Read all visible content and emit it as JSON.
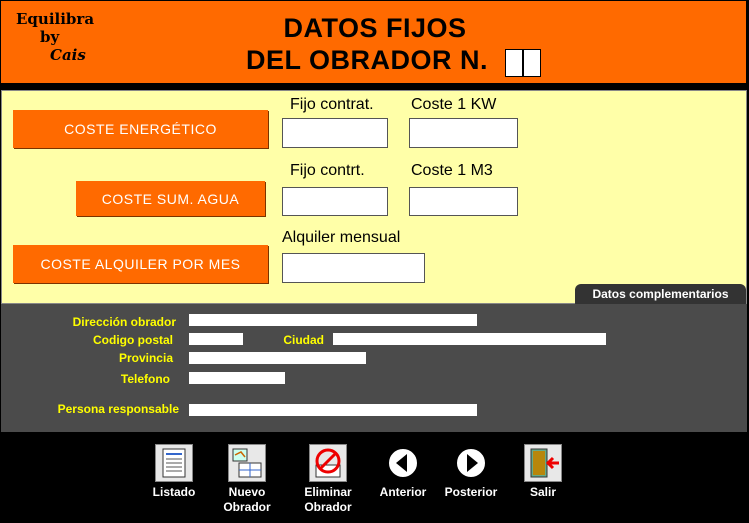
{
  "brand": {
    "line1": "Equilibra",
    "line2": "by",
    "line3": "Cais"
  },
  "header": {
    "title_line1": "DATOS FIJOS",
    "title_line2": "DEL OBRADOR N."
  },
  "costs": {
    "energy": {
      "button": "COSTE  ENERGÉTICO",
      "label1": "Fijo contrat.",
      "label2": "Coste 1 KW",
      "value1": "",
      "value2": ""
    },
    "water": {
      "button": "COSTE SUM. AGUA",
      "label1": "Fijo contrt.",
      "label2": "Coste 1 M3",
      "value1": "",
      "value2": ""
    },
    "rent": {
      "button": "COSTE ALQUILER POR MES",
      "label1": "Alquiler mensual",
      "value1": ""
    }
  },
  "tab": {
    "label": "Datos complementarios"
  },
  "details": {
    "address": {
      "label": "Dirección obrador",
      "value": ""
    },
    "postal": {
      "label": "Codigo postal",
      "value": ""
    },
    "city": {
      "label": "Ciudad",
      "value": ""
    },
    "province": {
      "label": "Provincia",
      "value": ""
    },
    "phone": {
      "label": "Telefono",
      "value": ""
    },
    "person": {
      "label": "Persona responsable",
      "value": ""
    }
  },
  "toolbar": {
    "list": "Listado",
    "new_l1": "Nuevo",
    "new_l2": "Obrador",
    "delete_l1": "Eliminar",
    "delete_l2": "Obrador",
    "prev": "Anterior",
    "next": "Posterior",
    "exit": "Salir"
  },
  "colors": {
    "header": "#ff6a00",
    "panel": "#ffffa8",
    "details": "#4b4b4b",
    "label_yellow": "#ffff00"
  }
}
